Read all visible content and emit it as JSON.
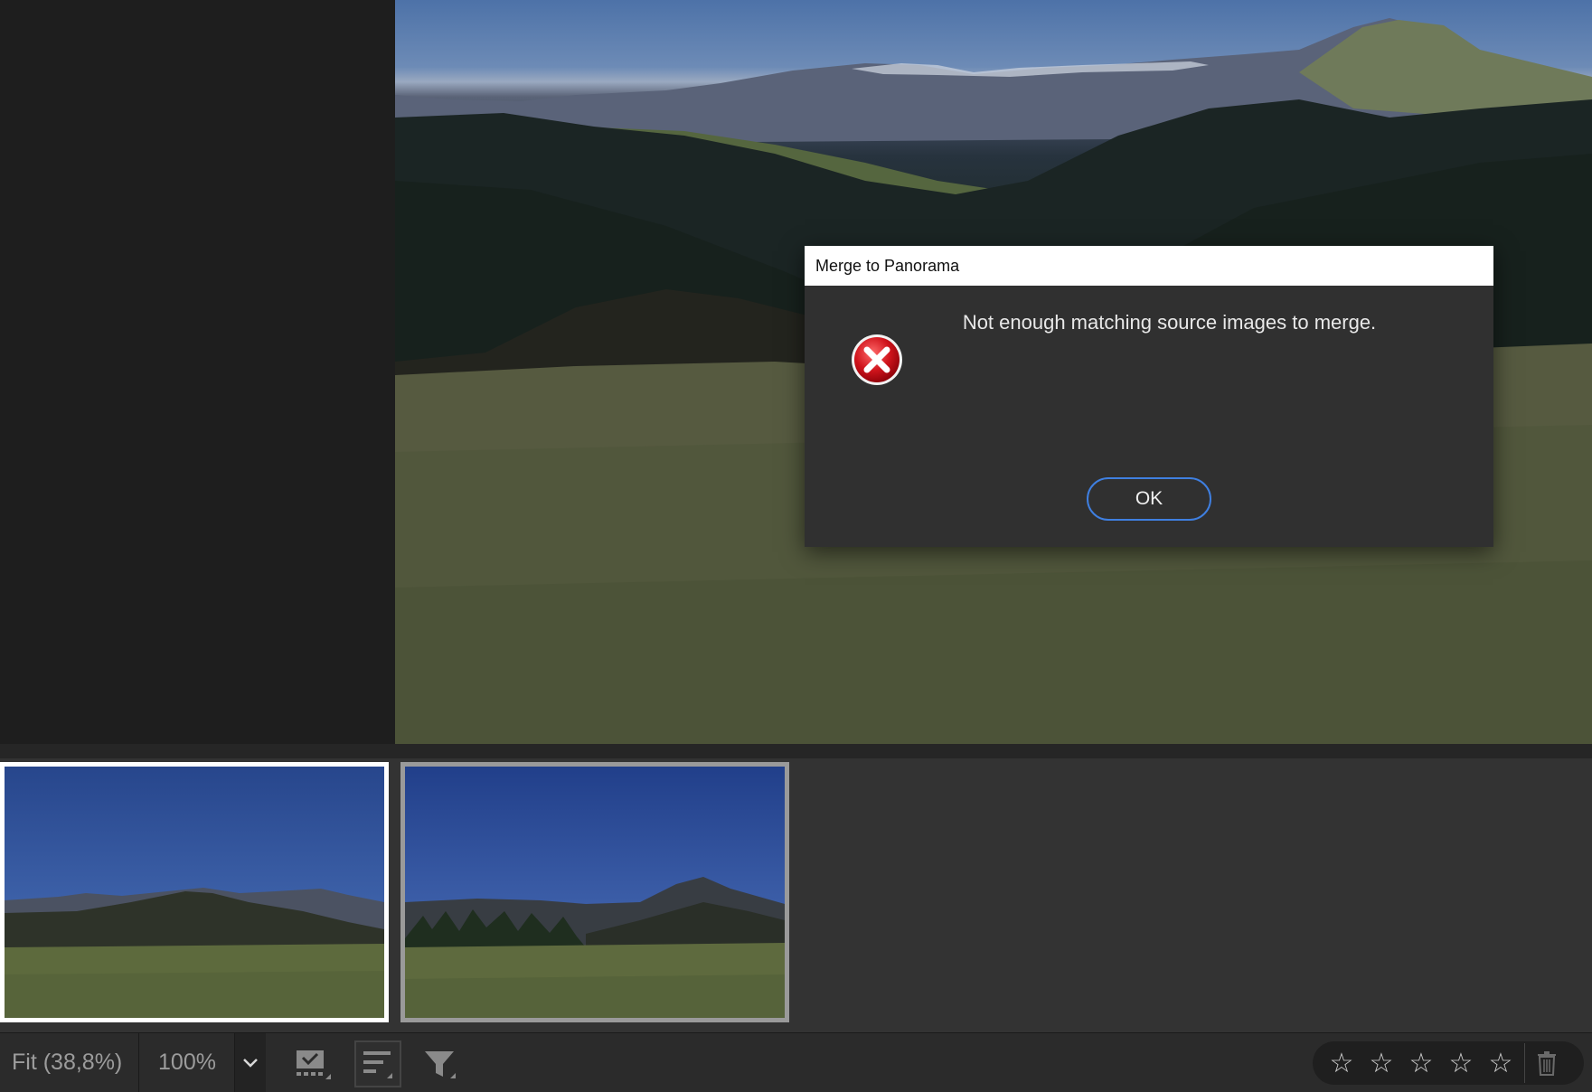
{
  "dialog": {
    "title": "Merge to Panorama",
    "message": "Not enough matching source images to merge.",
    "ok_label": "OK",
    "icon": "error-icon"
  },
  "filmstrip": {
    "items": [
      {
        "selected": true
      },
      {
        "selected": false
      }
    ]
  },
  "toolbar": {
    "zoom_fit_label": "Fit (38,8%)",
    "zoom_100_label": "100%",
    "zoom_dropdown_icon": "chevron-down-icon",
    "tools": [
      "select-images-icon",
      "sort-icon",
      "filter-icon"
    ],
    "rating": {
      "stars": 5,
      "value": 0
    },
    "delete_icon": "trash-icon"
  },
  "colors": {
    "dialog_bg": "#303030",
    "accent": "#3f7fe0",
    "error_red": "#d0141c"
  }
}
